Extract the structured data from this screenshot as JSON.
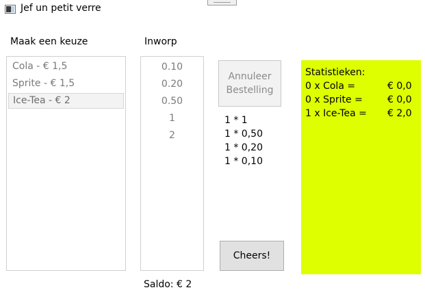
{
  "window": {
    "title": "Jef un petit verre"
  },
  "products": {
    "label": "Maak een keuze",
    "items": [
      {
        "label": "Cola - € 1,5",
        "selected": false
      },
      {
        "label": "Sprite - € 1,5",
        "selected": false
      },
      {
        "label": "Ice-Tea - € 2",
        "selected": true
      }
    ]
  },
  "coins": {
    "label": "Inworp",
    "items": [
      "0.10",
      "0.20",
      "0.50",
      "1",
      "2"
    ]
  },
  "buttons": {
    "cancel": "Annuleer\nBestelling",
    "cheers": "Cheers!"
  },
  "change": [
    "1 * 1",
    "1 * 0,50",
    "1 * 0,20",
    "1 * 0,10"
  ],
  "stats": {
    "title": "Statistieken:",
    "rows": [
      {
        "name": "0 x Cola =",
        "amount": "€ 0,0"
      },
      {
        "name": "0 x Sprite =",
        "amount": "€ 0,0"
      },
      {
        "name": "1 x Ice-Tea =",
        "amount": "€ 2,0"
      }
    ],
    "background": "#ddff00"
  },
  "saldo": "Saldo: € 2"
}
